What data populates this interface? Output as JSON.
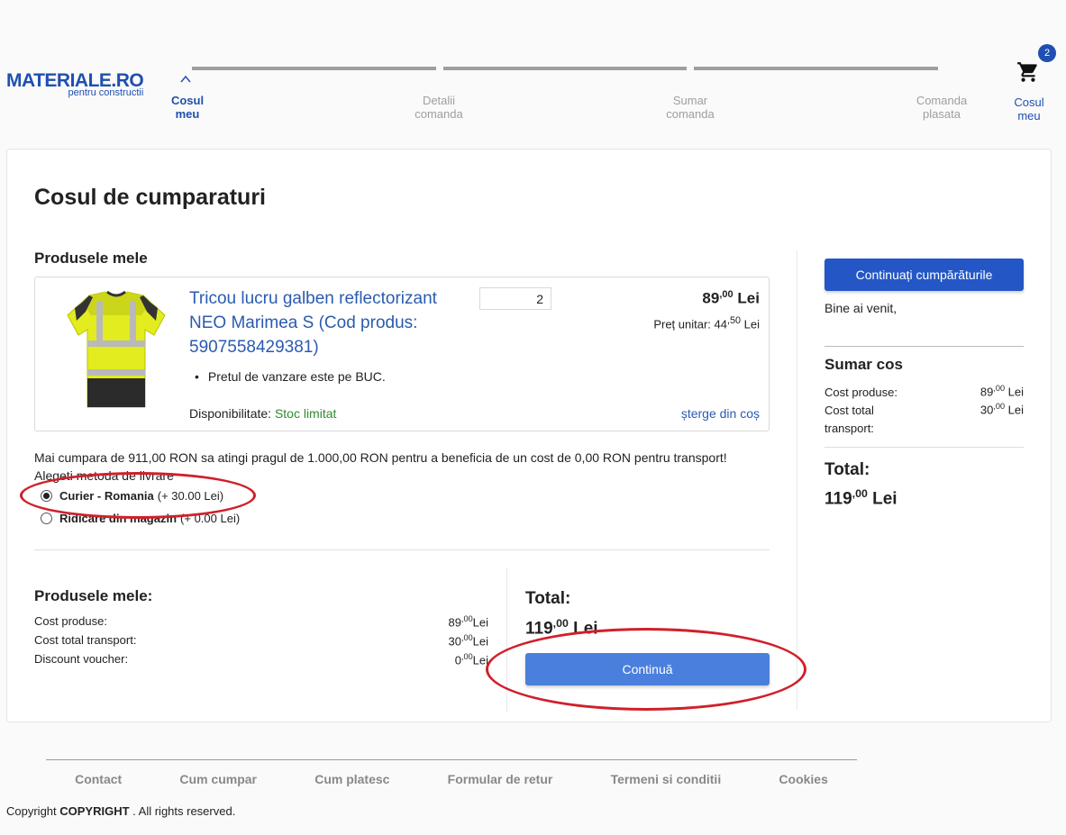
{
  "header": {
    "logo_main": "MATERIALE.RO",
    "logo_sub": "pentru constructii",
    "steps": [
      {
        "line1": "Cosul",
        "line2": "meu",
        "active": true
      },
      {
        "line1": "Detalii",
        "line2": "comanda",
        "active": false
      },
      {
        "line1": "Sumar",
        "line2": "comanda",
        "active": false
      },
      {
        "line1": "Comanda",
        "line2": "plasata",
        "active": false
      }
    ],
    "cart": {
      "badge": "2",
      "label_line1": "Cosul",
      "label_line2": "meu"
    }
  },
  "main": {
    "title": "Cosul de cumparaturi",
    "section_title": "Produsele mele",
    "product": {
      "name": "Tricou lucru galben reflectorizant NEO Marimea S (Cod produs: 5907558429381)",
      "quantity": "2",
      "price_int": "89",
      "price_dec": ",00",
      "price_currency": " Lei",
      "unit_label": "Preț unitar: 44",
      "unit_dec": ",50",
      "unit_currency": " Lei",
      "bullet": "Pretul de vanzare este pe BUC.",
      "availability_label": "Disponibilitate: ",
      "availability_value": "Stoc limitat",
      "remove_link": "șterge din coș"
    },
    "threshold_text": "Mai cumpara de 911,00 RON sa atingi pragul de 1.000,00 RON pentru a beneficia de un cost de 0,00 RON pentru transport!",
    "delivery_question": "Alegeti metoda de livrare",
    "delivery_options": [
      {
        "name": "Curier - Romania",
        "extra": "(+ 30.00 Lei)",
        "checked": true
      },
      {
        "name": "Ridicare din magazin",
        "extra": "(+ 0.00 Lei)",
        "checked": false
      }
    ],
    "summary": {
      "title": "Produsele mele:",
      "rows": [
        {
          "label": "Cost produse:",
          "int": "89",
          "dec": ",00",
          "cur": "Lei"
        },
        {
          "label": "Cost total transport:",
          "int": "30",
          "dec": ",00",
          "cur": "Lei"
        },
        {
          "label": "Discount voucher:",
          "int": "0",
          "dec": ",00",
          "cur": "Lei"
        }
      ]
    },
    "total_label": "Total:",
    "total_int": "119",
    "total_dec": ",00",
    "total_cur": " Lei",
    "continue_button": "Continuă"
  },
  "sidebar": {
    "continue_shopping_button": "Continuați cumpărăturile",
    "welcome": "Bine ai venit,",
    "summary_title": "Sumar cos",
    "rows": [
      {
        "label": "Cost produse:",
        "int": "89",
        "dec": ",00",
        "cur": " Lei"
      },
      {
        "label": "Cost total transport:",
        "int": "30",
        "dec": ",00",
        "cur": " Lei"
      }
    ],
    "total_label": "Total:",
    "total_int": "119",
    "total_dec": ",00",
    "total_cur": " Lei"
  },
  "footer": {
    "links": [
      "Contact",
      "Cum cumpar",
      "Cum platesc",
      "Formular de retur",
      "Termeni si conditii",
      "Cookies"
    ],
    "copyright_prefix": "Copyright ",
    "copyright_bold": "COPYRIGHT",
    "copyright_suffix": " . All rights reserved."
  },
  "colors": {
    "brand": "#1f4fb0",
    "link": "#2a5bb0",
    "stock": "#2e8b2e",
    "annotation": "#d0202a",
    "primary_button": "#4a7fdd"
  },
  "icons": [
    "chevron-up-icon",
    "cart-icon",
    "radio-icon"
  ]
}
